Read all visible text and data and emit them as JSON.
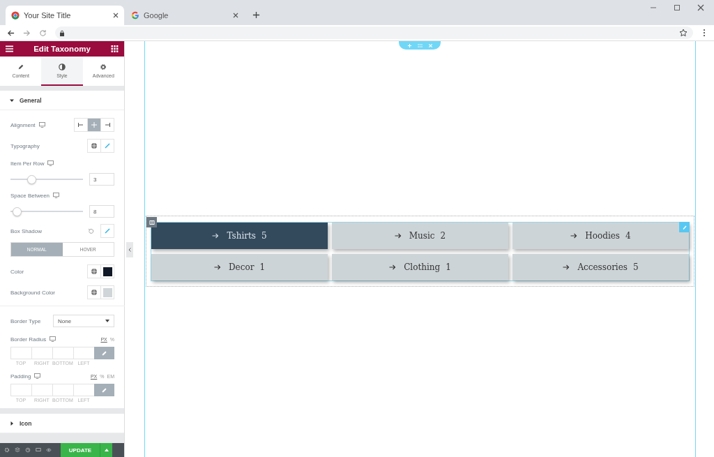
{
  "browser": {
    "tabs": [
      {
        "title": "Your Site Title",
        "kind": "chrome",
        "selected": true
      },
      {
        "title": "Google",
        "kind": "google",
        "selected": false
      }
    ]
  },
  "panel": {
    "title": "Edit Taxonomy",
    "tabs": [
      {
        "label": "Content",
        "kind": "pencil",
        "selected": false
      },
      {
        "label": "Style",
        "kind": "contrast",
        "selected": true
      },
      {
        "label": "Advanced",
        "kind": "gear",
        "selected": false
      }
    ],
    "sections": [
      {
        "title": "General",
        "expanded": true,
        "controls": [
          {
            "kind": "alignment",
            "label": "Alignment",
            "responsive": true,
            "options": [
              {
                "kind": "left",
                "selected": false
              },
              {
                "kind": "center",
                "selected": true
              },
              {
                "kind": "right",
                "selected": false
              }
            ]
          },
          {
            "kind": "typography",
            "label": "Typography",
            "responsive": false
          },
          {
            "kind": "slider",
            "label": "Item Per Row",
            "responsive": true,
            "level": 0.25,
            "value": "3"
          },
          {
            "kind": "slider",
            "label": "Space Between",
            "responsive": true,
            "level": 0.05,
            "value": "8"
          },
          {
            "kind": "shadow",
            "label": "Box Shadow",
            "responsive": false
          },
          {
            "kind": "toggle",
            "options": [
              {
                "label": "NORMAL",
                "selected": true
              },
              {
                "label": "HOVER",
                "selected": false
              }
            ]
          },
          {
            "kind": "color",
            "label": "Color",
            "responsive": false,
            "color": "#111827"
          },
          {
            "kind": "color",
            "label": "Background Color",
            "responsive": false,
            "color": "#cfd5d8"
          },
          {
            "kind": "select",
            "label": "Border Type",
            "responsive": false,
            "value": "None"
          },
          {
            "kind": "dimensions",
            "label": "Border Radius",
            "responsive": true,
            "units": [
              {
                "label": "PX",
                "selected": true
              },
              {
                "label": "%",
                "selected": false
              }
            ],
            "sides": [
              "TOP",
              "RIGHT",
              "BOTTOM",
              "LEFT"
            ]
          },
          {
            "kind": "dimensions",
            "label": "Padding",
            "responsive": true,
            "units": [
              {
                "label": "PX",
                "selected": true
              },
              {
                "label": "%",
                "selected": false
              },
              {
                "label": "EM",
                "selected": false
              }
            ],
            "sides": [
              "TOP",
              "RIGHT",
              "BOTTOM",
              "LEFT"
            ]
          }
        ]
      },
      {
        "title": "Icon",
        "expanded": false
      }
    ],
    "update_button": "UPDATE"
  },
  "canvas": {
    "items": [
      {
        "label": "Tshirts",
        "count": "5",
        "selected": true
      },
      {
        "label": "Music",
        "count": "2",
        "selected": false
      },
      {
        "label": "Hoodies",
        "count": "4",
        "selected": false
      },
      {
        "label": "Decor",
        "count": "1",
        "selected": false
      },
      {
        "label": "Clothing",
        "count": "1",
        "selected": false
      },
      {
        "label": "Accessories",
        "count": "5",
        "selected": false
      }
    ]
  }
}
